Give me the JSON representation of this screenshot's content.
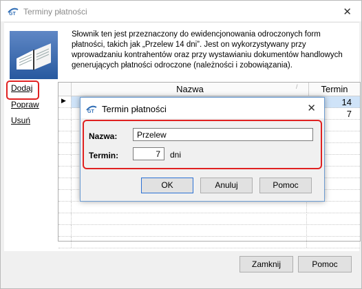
{
  "window": {
    "title": "Terminy płatności",
    "close_glyph": "✕"
  },
  "description": "Słownik ten jest przeznaczony do ewidencjonowania odroczonych form płatności, takich jak „Przelew 14 dni”. Jest on wykorzystywany przy wprowadzaniu kontrahentów oraz przy wystawianiu dokumentów handlowych generujących płatności odroczone (należności i zobowiązania).",
  "side_links": {
    "add": "Dodaj",
    "edit": "Popraw",
    "delete": "Usuń"
  },
  "grid": {
    "columns": {
      "name": "Nazwa",
      "term": "Termin",
      "sort_glyph": "/"
    },
    "rows": [
      {
        "name": "",
        "term": "14",
        "active": true
      },
      {
        "name": "",
        "term": "7",
        "active": false
      },
      {
        "name": "",
        "term": "",
        "active": false
      },
      {
        "name": "",
        "term": "",
        "active": false
      },
      {
        "name": "",
        "term": "",
        "active": false
      },
      {
        "name": "",
        "term": "",
        "active": false
      },
      {
        "name": "",
        "term": "",
        "active": false
      },
      {
        "name": "",
        "term": "",
        "active": false
      },
      {
        "name": "",
        "term": "",
        "active": false
      },
      {
        "name": "",
        "term": "",
        "active": false
      },
      {
        "name": "",
        "term": "",
        "active": false
      },
      {
        "name": "",
        "term": "",
        "active": false
      },
      {
        "name": "",
        "term": "",
        "active": false
      }
    ]
  },
  "dialog": {
    "title": "Termin płatności",
    "close_glyph": "✕",
    "name_label": "Nazwa:",
    "name_value": "Przelew",
    "term_label": "Termin:",
    "term_value": "7",
    "term_unit": "dni",
    "ok_label": "OK",
    "cancel_label": "Anuluj",
    "help_label": "Pomoc"
  },
  "footer": {
    "close_label": "Zamknij",
    "help_label": "Pomoc"
  },
  "colors": {
    "highlight": "#e02020",
    "selection": "#cfe3f8",
    "accent": "#2a70d4"
  }
}
